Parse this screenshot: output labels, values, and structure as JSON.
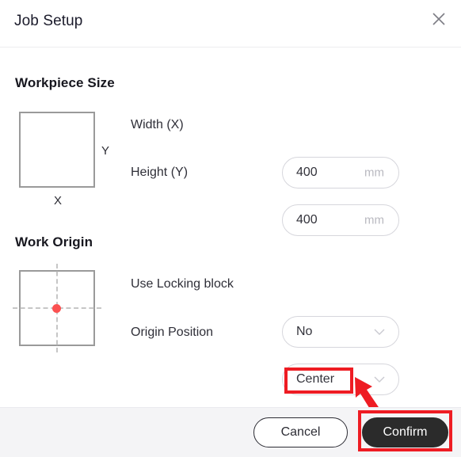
{
  "dialog": {
    "title": "Job Setup",
    "close_icon": "close-icon"
  },
  "sections": {
    "workpiece": {
      "title": "Workpiece Size",
      "diagram": {
        "x_axis_label": "X",
        "y_axis_label": "Y"
      },
      "fields": [
        {
          "label": "Width (X)",
          "value": "400",
          "unit": "mm"
        },
        {
          "label": "Height (Y)",
          "value": "400",
          "unit": "mm"
        }
      ]
    },
    "origin": {
      "title": "Work Origin",
      "fields": [
        {
          "label": "Use Locking block",
          "value": "No"
        },
        {
          "label": "Origin Position",
          "value": "Center"
        }
      ]
    }
  },
  "footer": {
    "cancel_label": "Cancel",
    "confirm_label": "Confirm"
  },
  "annotations": {
    "highlight_color": "#ee1c23",
    "origin_dot_color": "#fb5151"
  }
}
